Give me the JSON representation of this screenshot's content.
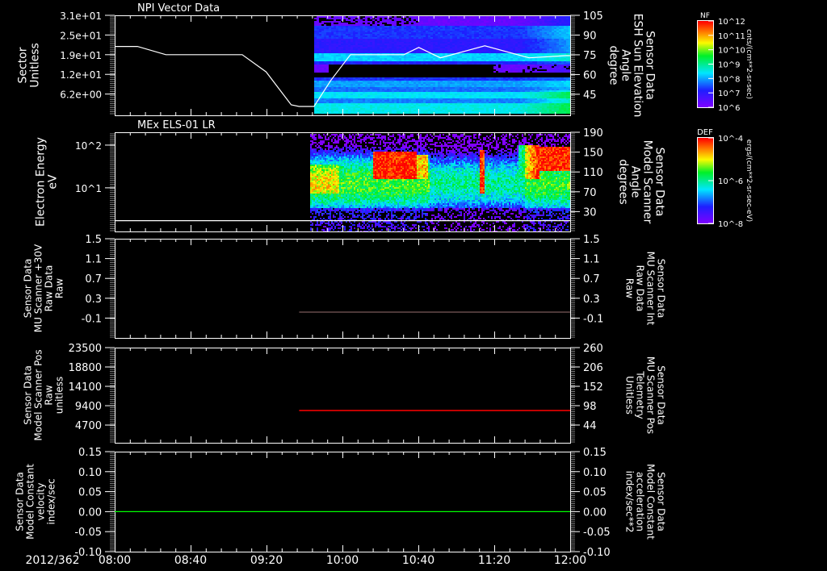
{
  "time_axis": {
    "date": "2012/362",
    "labels": [
      "08:00",
      "08:40",
      "09:20",
      "10:00",
      "10:40",
      "11:20",
      "12:00"
    ],
    "range_hours": [
      8,
      12
    ]
  },
  "colorbars": [
    {
      "name": "NF",
      "ticks": [
        "10^12",
        "10^11",
        "10^10",
        "10^9",
        "10^8",
        "10^7",
        "10^6"
      ],
      "units": "cnts/(cm**2-sr-sec)"
    },
    {
      "name": "DEF",
      "ticks": [
        "10^-4",
        "10^-6",
        "10^-8"
      ],
      "units": "ergs/(cm**2-sr-sec-eV)"
    }
  ],
  "chart_data": [
    {
      "type": "line",
      "title": "NPI Vector Data",
      "left_label": [
        "Sector",
        "Unitless"
      ],
      "right_label": [
        "Sensor Data",
        "ESH Sun Elevation",
        "Angle",
        "degree"
      ],
      "left_color": "#ffffff",
      "right_color": "#ffffff",
      "left_ticks": [
        {
          "v": 31,
          "t": "3.1e+01"
        },
        {
          "v": 24.8,
          "t": "2.5e+01"
        },
        {
          "v": 18.6,
          "t": "1.9e+01"
        },
        {
          "v": 12.4,
          "t": "1.2e+01"
        },
        {
          "v": 6.2,
          "t": "6.2e+00"
        }
      ],
      "right_ticks": [
        {
          "v": 105,
          "t": "105"
        },
        {
          "v": 90,
          "t": "90"
        },
        {
          "v": 75,
          "t": "75"
        },
        {
          "v": 60,
          "t": "60"
        },
        {
          "v": 45,
          "t": "45"
        }
      ],
      "ylim": [
        -0.5,
        31
      ],
      "ylim_right": [
        29,
        105
      ],
      "spectrogram": "NF",
      "spectrogram_start_hour": 9.76,
      "series": [
        {
          "name": "Sector",
          "color": "#ffffff",
          "x": [
            8.0,
            8.2,
            8.45,
            9.12,
            9.33,
            9.55,
            9.62,
            9.75,
            9.9,
            10.07,
            10.54,
            10.67,
            10.86,
            11.25,
            11.64,
            11.96,
            12.0
          ],
          "y": [
            21.2,
            21.2,
            18.6,
            18.6,
            13.2,
            2.8,
            2.3,
            2.3,
            10.6,
            18.6,
            18.6,
            20.9,
            17.6,
            21.4,
            17.6,
            18.3,
            18.3
          ]
        }
      ]
    },
    {
      "type": "line",
      "title": "MEx ELS-01 LR",
      "left_label": [
        "Electron Energy",
        "eV"
      ],
      "right_label": [
        "Sensor Data",
        "Model Scanner",
        "Angle",
        "degrees"
      ],
      "left_color": "#ffffff",
      "right_color": "#ffffff",
      "left_ticks": [
        {
          "v": 100,
          "t": "10^2"
        },
        {
          "v": 10,
          "t": "10^1"
        }
      ],
      "right_ticks": [
        {
          "v": 190,
          "t": "190"
        },
        {
          "v": 150,
          "t": "150"
        },
        {
          "v": 110,
          "t": "110"
        },
        {
          "v": 70,
          "t": "70"
        },
        {
          "v": 30,
          "t": "30"
        }
      ],
      "ylim": [
        0.95,
        200
      ],
      "ylog": true,
      "ylim_right": [
        -10,
        190
      ],
      "spectrogram": "DEF",
      "spectrogram_start_hour": 9.72,
      "series": [
        {
          "name": "Scanner Angle",
          "color": "#ffffff",
          "x": [
            8.0,
            12.0
          ],
          "y": [
            1.7,
            1.7
          ]
        }
      ]
    },
    {
      "type": "line",
      "title": "",
      "left_label": [
        "Sensor Data",
        "MU Scanner +30V",
        "Raw Data",
        "Raw"
      ],
      "right_label": [
        "Sensor Data",
        "MU Scanner Int",
        "Raw Data",
        "Raw"
      ],
      "left_color": "#ffffff",
      "right_color": "#ff0000",
      "left_ticks": [
        {
          "v": 1.5,
          "t": "1.5"
        },
        {
          "v": 1.1,
          "t": "1.1"
        },
        {
          "v": 0.7,
          "t": "0.7"
        },
        {
          "v": 0.3,
          "t": "0.3"
        },
        {
          "v": -0.1,
          "t": "-0.1"
        }
      ],
      "right_ticks": [
        {
          "v": 1.5,
          "t": "1.5"
        },
        {
          "v": 1.1,
          "t": "1.1"
        },
        {
          "v": 0.7,
          "t": "0.7"
        },
        {
          "v": 0.3,
          "t": "0.3"
        },
        {
          "v": -0.1,
          "t": "-0.1"
        }
      ],
      "ylim": [
        -0.5,
        1.5
      ],
      "ylim_right": [
        -0.5,
        1.5
      ],
      "series": [
        {
          "name": "MU Scanner Int",
          "color": "#7a5a5a",
          "x": [
            9.62,
            12.0
          ],
          "y": [
            0.02,
            0.02
          ]
        }
      ]
    },
    {
      "type": "line",
      "title": "",
      "left_label": [
        "Sensor Data",
        "Model Scanner Pos",
        "Raw",
        "unitless"
      ],
      "right_label": [
        "Sensor Data",
        "MU Scanner Pos",
        "Telemetry",
        "Unitless"
      ],
      "left_color": "#ffffff",
      "right_color": "#ff0000",
      "left_ticks": [
        {
          "v": 23500,
          "t": "23500"
        },
        {
          "v": 18800,
          "t": "18800"
        },
        {
          "v": 14100,
          "t": "14100"
        },
        {
          "v": 9400,
          "t": "9400"
        },
        {
          "v": 4700,
          "t": "4700"
        }
      ],
      "right_ticks": [
        {
          "v": 260,
          "t": "260"
        },
        {
          "v": 206,
          "t": "206"
        },
        {
          "v": 152,
          "t": "152"
        },
        {
          "v": 98,
          "t": "98"
        },
        {
          "v": 44,
          "t": "44"
        }
      ],
      "ylim": [
        400,
        23500
      ],
      "ylim_right": [
        -5.5,
        260
      ],
      "series": [
        {
          "name": "MU Scanner Pos",
          "color": "#ff0000",
          "axis": "right",
          "x": [
            9.62,
            12.0
          ],
          "y": [
            84.5,
            84.5
          ]
        }
      ]
    },
    {
      "type": "line",
      "title": "",
      "left_label": [
        "Sensor Data",
        "Model Constant",
        "velocity",
        "index/sec"
      ],
      "right_label": [
        "Sensor Data",
        "Model Constant",
        "acceleration",
        "index/sec**2"
      ],
      "left_color": "#ffffff",
      "right_color": "#00ff00",
      "left_ticks": [
        {
          "v": 0.15,
          "t": "0.15"
        },
        {
          "v": 0.1,
          "t": "0.10"
        },
        {
          "v": 0.05,
          "t": "0.05"
        },
        {
          "v": 0,
          "t": "0.00"
        },
        {
          "v": -0.05,
          "t": "-0.05"
        },
        {
          "v": -0.1,
          "t": "-0.10"
        }
      ],
      "right_ticks": [
        {
          "v": 0.15,
          "t": "0.15"
        },
        {
          "v": 0.1,
          "t": "0.10"
        },
        {
          "v": 0.05,
          "t": "0.05"
        },
        {
          "v": 0,
          "t": "0.00"
        },
        {
          "v": -0.05,
          "t": "-0.05"
        },
        {
          "v": -0.1,
          "t": "-0.10"
        }
      ],
      "ylim": [
        -0.1,
        0.15
      ],
      "ylim_right": [
        -0.1,
        0.15
      ],
      "series": [
        {
          "name": "Model Constant acceleration",
          "color": "#00ff00",
          "x": [
            8.0,
            12.0
          ],
          "y": [
            0,
            0
          ]
        }
      ]
    }
  ]
}
